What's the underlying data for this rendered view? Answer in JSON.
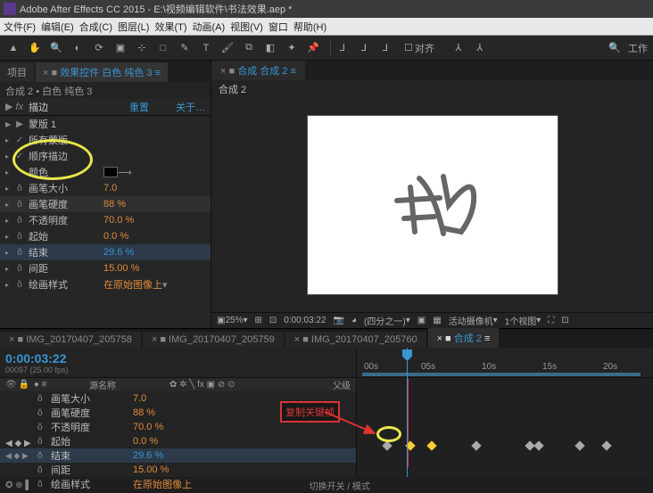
{
  "title": "Adobe After Effects CC 2015 - E:\\视频编辑软件\\书法效果.aep *",
  "menus": [
    "文件(F)",
    "编辑(E)",
    "合成(C)",
    "图层(L)",
    "效果(T)",
    "动画(A)",
    "视图(V)",
    "窗口",
    "帮助(H)"
  ],
  "toolbar_right": "工作",
  "snap_label": "对齐",
  "project_tabs": {
    "proj": "项目",
    "fx": "效果控件",
    "fx_target": "白色 纯色 3"
  },
  "breadcrumb": "合成 2 • 白色 纯色 3",
  "fx": {
    "toggle": "fx",
    "name": "描边",
    "reset": "重置",
    "about": "关于…",
    "rows": [
      {
        "sw": "▶",
        "lbl": "蒙版 1",
        "val": "",
        "cls": ""
      },
      {
        "sw": "✓",
        "lbl": "所有蒙版",
        "val": "",
        "cls": ""
      },
      {
        "sw": "✓",
        "lbl": "顺序描边",
        "val": "",
        "cls": ""
      },
      {
        "sw": "",
        "lbl": "颜色",
        "val": "swatch",
        "cls": ""
      },
      {
        "sw": "ŏ",
        "lbl": "画笔大小",
        "val": "7.0",
        "cls": ""
      },
      {
        "sw": "ŏ",
        "lbl": "画笔硬度",
        "val": "88 %",
        "cls": "",
        "hover": true
      },
      {
        "sw": "ŏ",
        "lbl": "不透明度",
        "val": "70.0 %",
        "cls": ""
      },
      {
        "sw": "ŏ",
        "lbl": "起始",
        "val": "0.0 %",
        "cls": ""
      },
      {
        "sw": "ŏ",
        "lbl": "结束",
        "val": "29.6 %",
        "cls": "blue",
        "hl": true
      },
      {
        "sw": "ŏ",
        "lbl": "间距",
        "val": "15.00 %",
        "cls": ""
      },
      {
        "sw": "ŏ",
        "lbl": "绘画样式",
        "val": "在原始图像上",
        "cls": "",
        "dd": true
      }
    ]
  },
  "viewer": {
    "tab_prefix": "合成",
    "tab_name": "合成 2",
    "crumb": "合成 2",
    "zoom": "25%",
    "time": "0:00:03:22",
    "res": "(四分之一)",
    "camera": "活动摄像机",
    "views": "1个视图"
  },
  "tl_tabs": [
    "IMG_20170407_205758",
    "IMG_20170407_205759",
    "IMG_20170407_205760"
  ],
  "tl_active": "合成 2",
  "tl_time": "0:00:03:22",
  "tl_fps": "00097 (25.00 fps)",
  "tl_cols": {
    "c2": "源名称",
    "c3": "父级"
  },
  "tl_rows": [
    {
      "kd": "",
      "sw": "ŏ",
      "nm": "画笔大小",
      "v": "7.0",
      "cls": ""
    },
    {
      "kd": "",
      "sw": "ŏ",
      "nm": "画笔硬度",
      "v": "88 %",
      "cls": ""
    },
    {
      "kd": "",
      "sw": "ŏ",
      "nm": "不透明度",
      "v": "70.0 %",
      "cls": ""
    },
    {
      "kd": "",
      "sw": "ŏ",
      "nm": "起始",
      "v": "0.0 %",
      "cls": ""
    },
    {
      "kd": "◀ ◆ ▶",
      "sw": "ŏ",
      "nm": "结束",
      "v": "29.6 %",
      "cls": "blue",
      "hl": true
    },
    {
      "kd": "",
      "sw": "ŏ",
      "nm": "间距",
      "v": "15.00 %",
      "cls": ""
    },
    {
      "kd": "",
      "sw": "ŏ",
      "nm": "绘画样式",
      "v": "在原始图像上",
      "cls": ""
    }
  ],
  "ruler": [
    "00s",
    "05s",
    "10s",
    "15s",
    "20s"
  ],
  "kfs": [
    30,
    56,
    80,
    130,
    190,
    200,
    246,
    276
  ],
  "annotation": "复制关键帧",
  "footer_mode": "切换开关 / 模式"
}
